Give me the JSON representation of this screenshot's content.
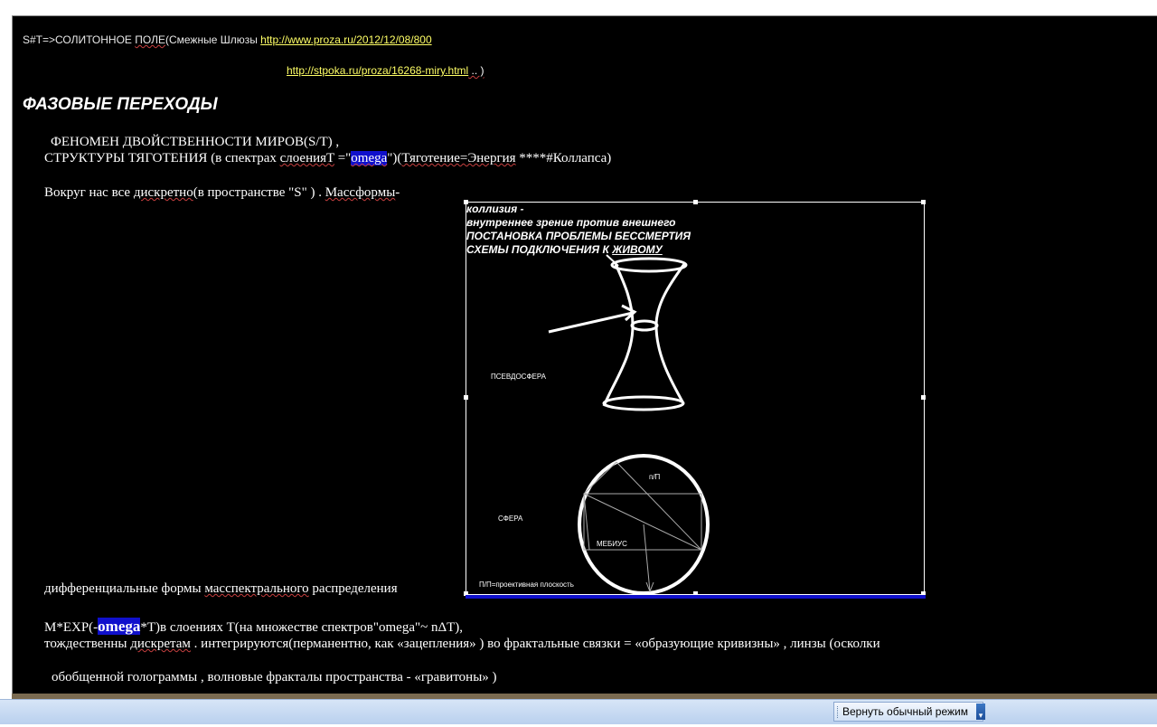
{
  "header": {
    "prefix": "S#T=>СОЛИТОННОЕ ",
    "pole": "ПОЛЕ",
    "paren_text": "(Смежные Шлюзы  ",
    "link1": "http://www.proza.ru/2012/12/08/800",
    "link2": "http://stpoka.ru/proza/16268-miry.html",
    "link2_tail": " .. )"
  },
  "heading": "ФАЗОВЫЕ ПЕРЕХОДЫ",
  "body": {
    "line1": "ФЕНОМЕН      ДВОЙСТВЕННОСТИ МИРОВ(S/T) ,",
    "line2_a": "СТРУКТУРЫ  ТЯГОТЕНИЯ  (в спектрах ",
    "line2_b": "слоенияT",
    "line2_c": "  =\"",
    "omega": "omega",
    "line2_d": "\")(",
    "line2_e": "Тяготение=Энергия",
    "line2_f": " ****#Коллапса)",
    "line3_a": "Вокруг  нас  все  ",
    "line3_b": "дискретно",
    "line3_c": "(в пространстве \"S\" )  . ",
    "line3_d": "Массформы",
    "line3_e": "-",
    "line4_a": "дифференциальные  формы ",
    "line4_b": "масспектрального",
    "line4_c": "  распределения",
    "line5_a": "M*EXP(-",
    "line5_omega": "omega",
    "line5_b": "*T)в слоениях T(на множестве спектров\"omega\"~ nΔT),",
    "line6_a": "тождественны  ",
    "line6_b": "дискретам",
    "line6_c": "  .   интегрируются(перманентно, как  «зацепления» ) во  фрактальные  связки = «образующие кривизны» , линзы (осколки",
    "line7": "обобщенной голограммы , волновые фракталы  пространства -  «гравитоны» )"
  },
  "figure": {
    "caption1": "коллизия  -",
    "caption2": "внутреннее зрение против внешнего",
    "caption3": "ПОСТАНОВКА ПРОБЛЕМЫ БЕССМЕРТИЯ",
    "caption4_a": "СХЕМЫ ПОДКЛЮЧЕНИЯ К ",
    "caption4_b": "ЖИВОМУ",
    "label_pseudosphere": "ПСЕВДОСФЕРА",
    "label_sphere": "СФЕРА",
    "label_pp": "п/П",
    "label_mobius": "МЕБИУС",
    "label_proj": "П/П=проективная  плоскость"
  },
  "taskbar": {
    "return_button": "Вернуть обычный режим"
  },
  "colors": {
    "page_bg": "#000000",
    "link": "#ffff66",
    "highlight": "#1010cc"
  }
}
